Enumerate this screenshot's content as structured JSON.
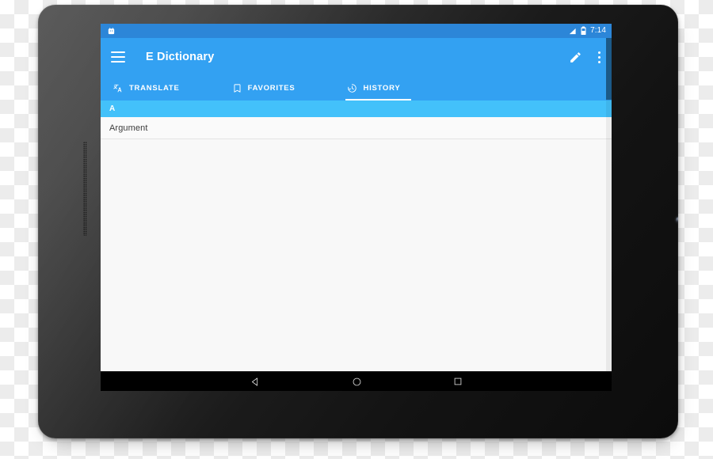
{
  "device": {
    "type": "android-tablet",
    "bezel_color": "#1b1b1b",
    "screen_bg": "#f8f8f8"
  },
  "status_bar": {
    "background": "#2c86d8",
    "clock": "7:14",
    "notification_icon": "android-app-notification-icon",
    "signal_icon": "signal-bars-icon",
    "battery_icon": "battery-icon"
  },
  "app_bar": {
    "background": "#33a1f2",
    "title": "E Dictionary",
    "menu_icon": "hamburger-menu-icon",
    "edit_icon": "pencil-edit-icon",
    "overflow_icon": "overflow-menu-icon"
  },
  "tabs": {
    "active_index": 2,
    "indicator_color": "#ffffff",
    "items": [
      {
        "label": "TRANSLATE",
        "icon": "translate-icon",
        "active": false
      },
      {
        "label": "FAVORITES",
        "icon": "bookmark-icon",
        "active": false
      },
      {
        "label": "HISTORY",
        "icon": "history-clock-icon",
        "active": true
      }
    ]
  },
  "content": {
    "section_header": {
      "label": "A",
      "background": "#43c1fa"
    },
    "items": [
      {
        "label": "Argument"
      }
    ],
    "scrollbar": {
      "thumb_color": "#000000"
    }
  },
  "nav_bar": {
    "background": "#000000",
    "buttons": [
      {
        "name": "back",
        "icon": "back-triangle-icon"
      },
      {
        "name": "home",
        "icon": "home-circle-icon"
      },
      {
        "name": "recents",
        "icon": "recents-square-icon"
      }
    ]
  }
}
